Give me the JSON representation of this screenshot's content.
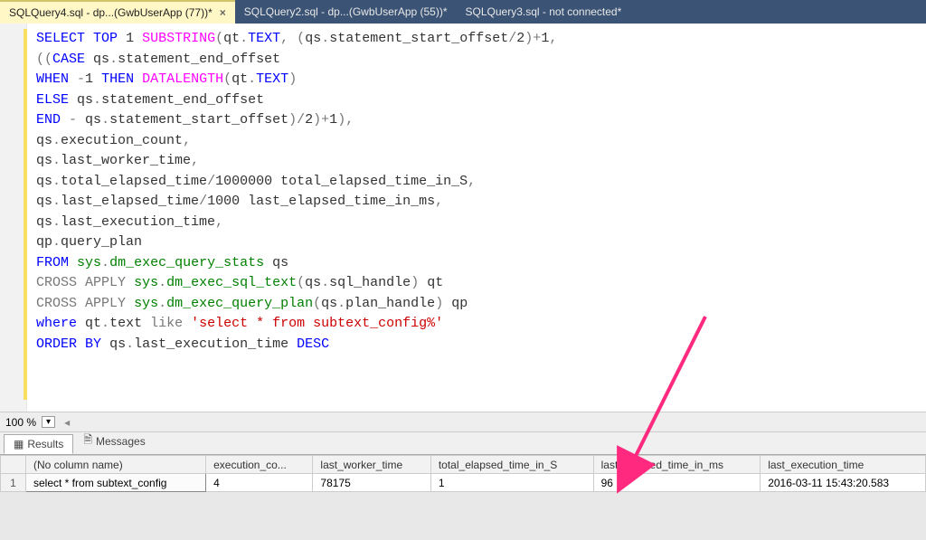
{
  "tabs": [
    {
      "label": "SQLQuery4.sql - dp...(GwbUserApp (77))*",
      "active": true
    },
    {
      "label": "SQLQuery2.sql - dp...(GwbUserApp (55))*",
      "active": false
    },
    {
      "label": "SQLQuery3.sql - not connected*",
      "active": false
    }
  ],
  "zoom": {
    "value": "100 %"
  },
  "panes": {
    "results": "Results",
    "messages": "Messages"
  },
  "sql": {
    "l1a": "SELECT",
    "l1b": "TOP",
    "l1c": "1",
    "l1d": "SUBSTRING",
    "l1e": "qt",
    "l1f": "TEXT",
    "l1g": "qs",
    "l1h": "statement_start_offset",
    "l1i": "2",
    "l1j": "1",
    "l2a": "CASE",
    "l2b": "qs",
    "l2c": "statement_end_offset",
    "l3a": "WHEN",
    "l3b": "-",
    "l3c": "1",
    "l3d": "THEN",
    "l3e": "DATALENGTH",
    "l3f": "qt",
    "l3g": "TEXT",
    "l4a": "ELSE",
    "l4b": "qs",
    "l4c": "statement_end_offset",
    "l5a": "END",
    "l5b": "qs",
    "l5c": "statement_start_offset",
    "l5d": "2",
    "l5e": "1",
    "l6a": "qs",
    "l6b": "execution_count",
    "l7a": "qs",
    "l7b": "last_worker_time",
    "l8a": "qs",
    "l8b": "total_elapsed_time",
    "l8c": "1000000",
    "l8d": "total_elapsed_time_in_S",
    "l9a": "qs",
    "l9b": "last_elapsed_time",
    "l9c": "1000",
    "l9d": "last_elapsed_time_in_ms",
    "l10a": "qs",
    "l10b": "last_execution_time",
    "l11a": "qp",
    "l11b": "query_plan",
    "l12a": "FROM",
    "l12b": "sys",
    "l12c": "dm_exec_query_stats",
    "l12d": "qs",
    "l13a": "CROSS",
    "l13b": "APPLY",
    "l13c": "sys",
    "l13d": "dm_exec_sql_text",
    "l13e": "qs",
    "l13f": "sql_handle",
    "l13g": "qt",
    "l14a": "CROSS",
    "l14b": "APPLY",
    "l14c": "sys",
    "l14d": "dm_exec_query_plan",
    "l14e": "qs",
    "l14f": "plan_handle",
    "l14g": "qp",
    "l15a": "where",
    "l15b": "qt",
    "l15c": "text",
    "l15d": "like",
    "l15e": "'select * from subtext_config%'",
    "l16a": "ORDER",
    "l16b": "BY",
    "l16c": "qs",
    "l16d": "last_execution_time",
    "l16e": "DESC"
  },
  "results": {
    "headers": [
      "(No column name)",
      "execution_co...",
      "last_worker_time",
      "total_elapsed_time_in_S",
      "last_elapsed_time_in_ms",
      "last_execution_time"
    ],
    "rows": [
      {
        "n": "1",
        "c0": "select * from subtext_config",
        "c1": "4",
        "c2": "78175",
        "c3": "1",
        "c4": "96",
        "c5": "2016-03-11 15:43:20.583"
      }
    ]
  },
  "icons": {
    "close": "×",
    "dropdown": "▾",
    "scroll_l": "◂",
    "results_ico": "▦",
    "msg_ico": "🗎"
  }
}
